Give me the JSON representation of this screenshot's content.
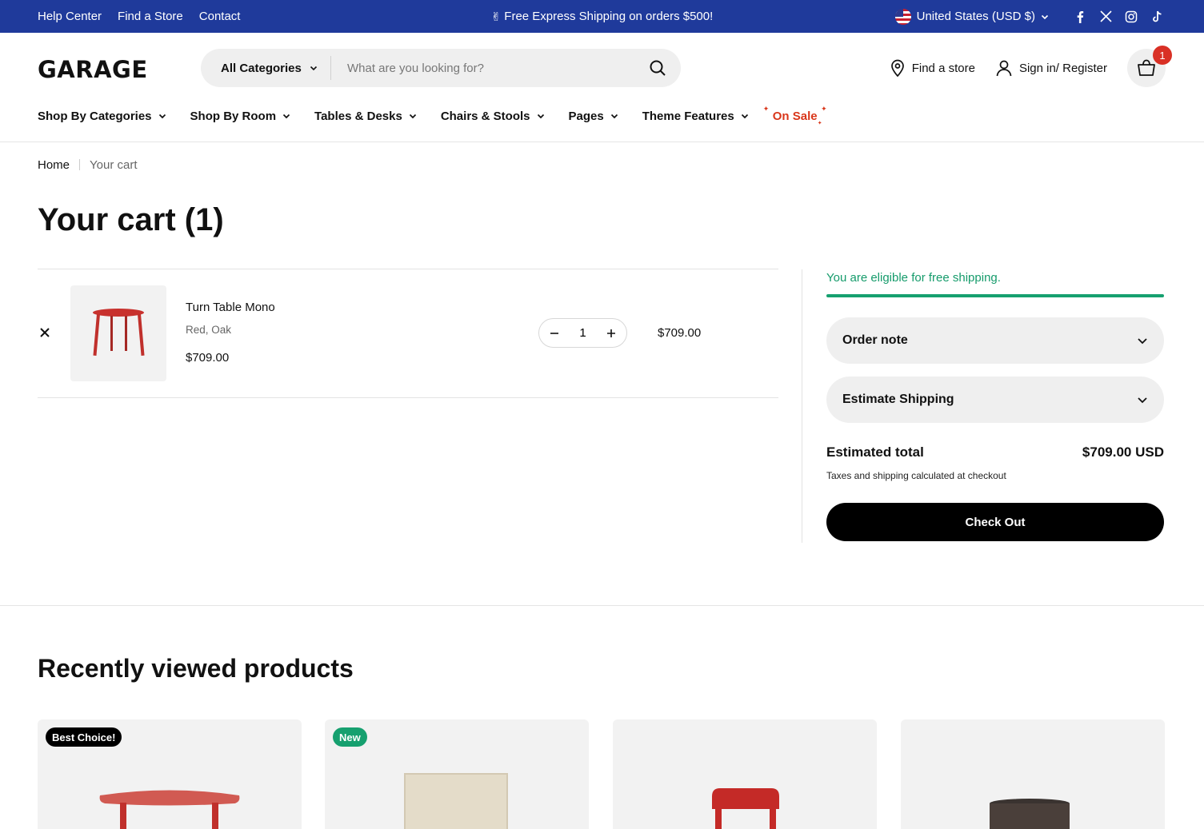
{
  "topbar": {
    "links": [
      "Help Center",
      "Find a Store",
      "Contact"
    ],
    "promo_emoji": "✌",
    "promo": "Free Express Shipping on orders $500!",
    "currency": "United States (USD $)",
    "social": [
      "facebook-icon",
      "x-icon",
      "instagram-icon",
      "tiktok-icon"
    ]
  },
  "header": {
    "logo": "GARAGE",
    "search": {
      "category": "All Categories",
      "placeholder": "What are you looking for?"
    },
    "find_store": "Find a store",
    "sign_in": "Sign in/ Register",
    "cart_count": "1"
  },
  "nav": {
    "items": [
      "Shop By Categories",
      "Shop By Room",
      "Tables & Desks",
      "Chairs & Stools",
      "Pages",
      "Theme Features"
    ],
    "sale": "On Sale"
  },
  "breadcrumb": {
    "home": "Home",
    "current": "Your cart"
  },
  "cart": {
    "title": "Your cart (1)",
    "item": {
      "name": "Turn Table Mono",
      "variant": "Red, Oak",
      "price": "$709.00",
      "quantity": "1",
      "line_total": "$709.00"
    }
  },
  "summary": {
    "shipping_message": "You are eligible for free shipping.",
    "shipping_progress": 1.0,
    "order_note": "Order note",
    "estimate_shipping": "Estimate Shipping",
    "estimated_total_label": "Estimated total",
    "estimated_total": "$709.00 USD",
    "tax_note": "Taxes and shipping calculated at checkout",
    "checkout": "Check Out"
  },
  "recently_viewed": {
    "title": "Recently viewed products",
    "badges": [
      "Best Choice!",
      "New"
    ]
  },
  "colors": {
    "topbar": "#1f3a9b",
    "sale": "#d9361a",
    "success": "#16a06f",
    "badge": "#d93025"
  }
}
